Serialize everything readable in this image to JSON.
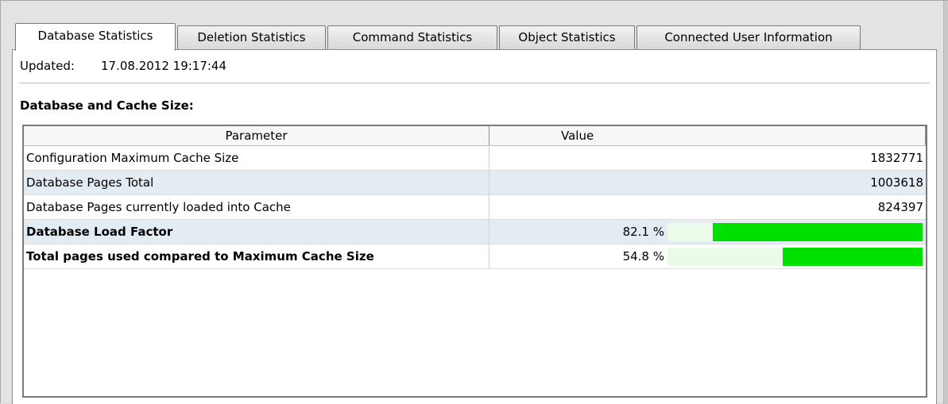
{
  "tabs": [
    {
      "label": "Database Statistics",
      "active": true
    },
    {
      "label": "Deletion Statistics",
      "active": false
    },
    {
      "label": "Command Statistics",
      "active": false
    },
    {
      "label": "Object Statistics",
      "active": false
    },
    {
      "label": "Connected User Information",
      "active": false
    }
  ],
  "updated": {
    "label": "Updated:",
    "value": "17.08.2012 19:17:44"
  },
  "section": {
    "title": "Database and Cache Size:"
  },
  "table": {
    "columns": [
      "Parameter",
      "Value"
    ],
    "rows": [
      {
        "parameter": "Configuration Maximum Cache Size",
        "value": "1832771"
      },
      {
        "parameter": "Database Pages Total",
        "value": "1003618"
      },
      {
        "parameter": "Database Pages currently loaded into Cache",
        "value": "824397"
      },
      {
        "parameter": "Database Load Factor",
        "value": "82.1 %",
        "progress": 0.821
      },
      {
        "parameter": "Total pages used compared to Maximum Cache Size",
        "value": "54.8 %",
        "progress": 0.548
      }
    ]
  },
  "colors": {
    "bar_fill": "#00e000",
    "bar_track": "#eafbea",
    "row_alt": "#e3ebf3"
  }
}
